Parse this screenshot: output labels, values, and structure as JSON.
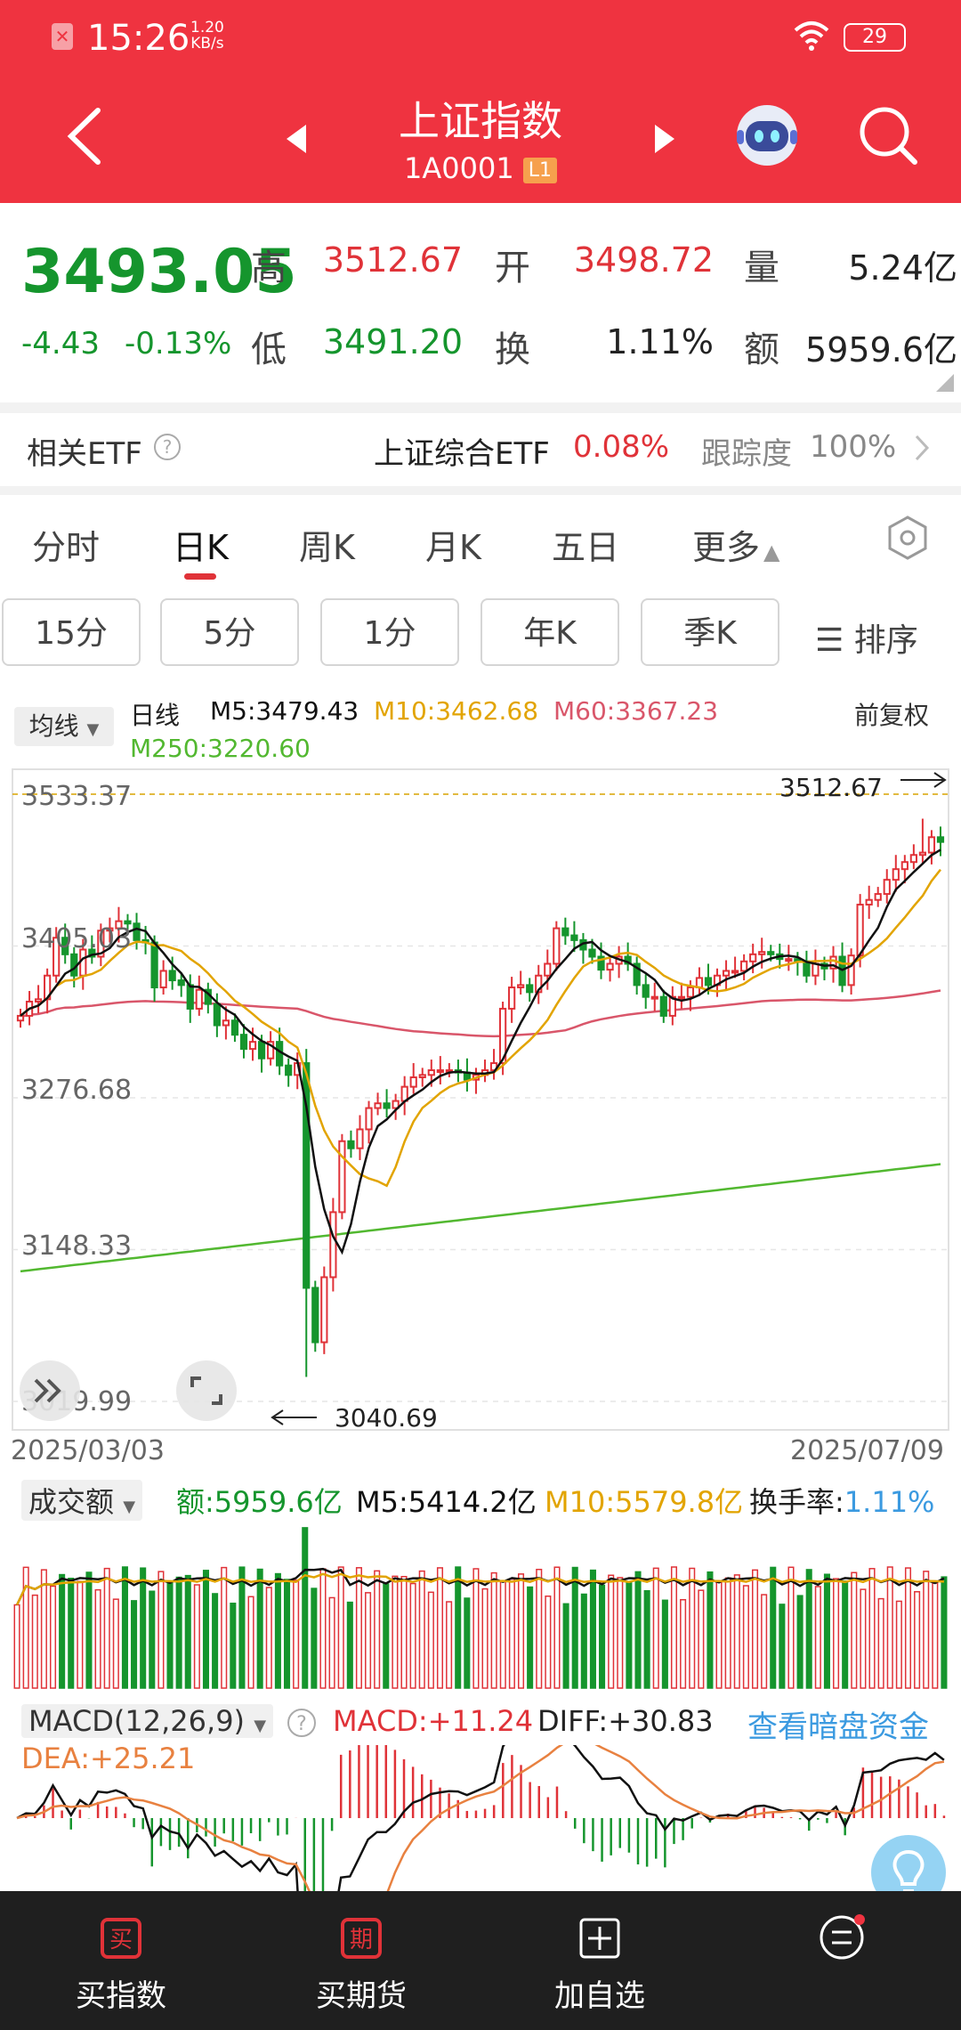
{
  "status_bar": {
    "time": "15:26",
    "speed_value": "1.20",
    "speed_unit": "KB/s",
    "battery": "29"
  },
  "header": {
    "title": "上证指数",
    "code": "1A0001",
    "level_badge": "L1"
  },
  "quote": {
    "price": "3493.05",
    "change": "-4.43",
    "change_pct": "-0.13%",
    "high_label": "高",
    "high": "3512.67",
    "low_label": "低",
    "low": "3491.20",
    "open_label": "开",
    "open": "3498.72",
    "turnover_label": "换",
    "turnover": "1.11%",
    "volume_label": "量",
    "volume": "5.24亿",
    "amount_label": "额",
    "amount": "5959.6亿"
  },
  "etf": {
    "label": "相关ETF",
    "name": "上证综合ETF",
    "pct": "0.08%",
    "tracking_label": "跟踪度",
    "tracking": "100%"
  },
  "period_tabs": [
    "分时",
    "日K",
    "周K",
    "月K",
    "五日",
    "更多"
  ],
  "interval_pills": [
    "15分",
    "5分",
    "1分",
    "年K",
    "季K"
  ],
  "sort_label": "排序",
  "kline_legend": {
    "selector": "均线",
    "period": "日线",
    "m5": "M5:3479.43",
    "m10": "M10:3462.68",
    "m60": "M60:3367.23",
    "m250": "M250:3220.60",
    "adjust": "前复权"
  },
  "kline_axis": {
    "y_labels": [
      "3533.37",
      "3405.03",
      "3276.68",
      "3148.33",
      "3019.99"
    ],
    "date_start": "2025/03/03",
    "date_end": "2025/07/09",
    "high_marker": "3512.67",
    "low_marker": "3040.69"
  },
  "volume_legend": {
    "selector": "成交额",
    "amount": "额:5959.6亿",
    "m5": "M5:5414.2亿",
    "m10": "M10:5579.8亿",
    "turnover_label": "换手率:",
    "turnover": "1.11%"
  },
  "macd_legend": {
    "selector": "MACD(12,26,9)",
    "macd": "MACD:+11.24",
    "diff": "DIFF:+30.83",
    "dea": "DEA:+25.21",
    "dark_pool_link": "查看暗盘资金"
  },
  "bottom_bar": {
    "items": [
      {
        "label": "买指数",
        "icon_text": "买"
      },
      {
        "label": "买期货",
        "icon_text": "期"
      },
      {
        "label": "加自选"
      },
      {
        "label": ""
      }
    ]
  },
  "colors": {
    "header_red": "#ef3340",
    "up_red": "#e03238",
    "down_green": "#15952d",
    "ma5": "#111111",
    "ma10": "#e2a400",
    "ma60": "#d9566a",
    "ma250": "#52b830"
  },
  "chart_data": {
    "type": "candlestick",
    "x_range": [
      "2025/03/03",
      "2025/07/09"
    ],
    "ylim": [
      3019.99,
      3533.37
    ],
    "y_ticks": [
      3533.37,
      3405.03,
      3276.68,
      3148.33,
      3019.99
    ],
    "close": [
      3346,
      3358,
      3360,
      3380,
      3412,
      3398,
      3380,
      3402,
      3396,
      3418,
      3420,
      3426,
      3424,
      3410,
      3408,
      3370,
      3384,
      3376,
      3372,
      3352,
      3368,
      3356,
      3338,
      3342,
      3330,
      3318,
      3324,
      3310,
      3324,
      3304,
      3296,
      3306,
      3116,
      3070,
      3125,
      3180,
      3240,
      3234,
      3250,
      3268,
      3272,
      3268,
      3274,
      3286,
      3294,
      3296,
      3300,
      3300,
      3300,
      3298,
      3292,
      3296,
      3300,
      3306,
      3352,
      3370,
      3372,
      3366,
      3380,
      3390,
      3420,
      3414,
      3410,
      3402,
      3396,
      3385,
      3390,
      3396,
      3390,
      3372,
      3362,
      3362,
      3346,
      3362,
      3362,
      3370,
      3378,
      3372,
      3380,
      3384,
      3384,
      3392,
      3398,
      3400,
      3398,
      3394,
      3394,
      3392,
      3380,
      3390,
      3386,
      3396,
      3372,
      3397,
      3440,
      3444,
      3449,
      3461,
      3470,
      3476,
      3482,
      3484,
      3497,
      3493
    ],
    "low_marker": 3040.69,
    "high_marker": 3512.67,
    "ma_names": [
      "M5",
      "M10",
      "M60",
      "M250"
    ]
  }
}
